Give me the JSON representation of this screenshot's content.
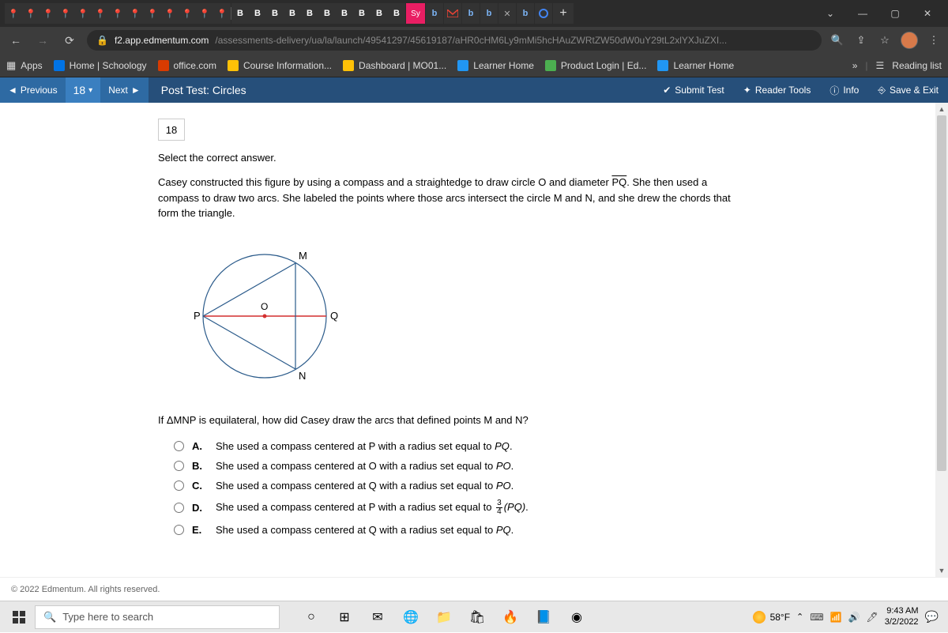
{
  "window": {
    "minimize": "—",
    "maximize": "▢",
    "close": "✕"
  },
  "tabs": {
    "pins": [
      "📍",
      "📍",
      "📍",
      "📍",
      "📍",
      "📍",
      "📍",
      "📍",
      "📍",
      "📍",
      "📍",
      "📍",
      "📍"
    ],
    "bs": [
      "B",
      "B",
      "B",
      "B",
      "B",
      "B",
      "B",
      "B",
      "B",
      "B"
    ],
    "sy": "Sy",
    "b1": "b",
    "m": "M",
    "b2": "b",
    "b3": "b",
    "x": "✕",
    "b4": "b",
    "plus": "+"
  },
  "url": {
    "lock": "🔒",
    "host": "f2.app.edmentum.com",
    "path": "/assessments-delivery/ua/la/launch/49541297/45619187/aHR0cHM6Ly9mMi5hcHAuZWRtZW50dW0uY29tL2xlYXJuZXI...",
    "search": "🔍",
    "share": "⇪",
    "star": "☆",
    "more": "⋮"
  },
  "bookmarks": {
    "apps": "Apps",
    "items": [
      {
        "icon": "#0073e6",
        "text": "Home | Schoology"
      },
      {
        "icon": "#d83b01",
        "text": "office.com"
      },
      {
        "icon": "#ffc107",
        "text": "Course Information..."
      },
      {
        "icon": "#ffc107",
        "text": "Dashboard | MO01..."
      },
      {
        "icon": "#2196f3",
        "text": "Learner Home"
      },
      {
        "icon": "#4caf50",
        "text": "Product Login | Ed..."
      },
      {
        "icon": "#2196f3",
        "text": "Learner Home"
      }
    ],
    "overflow": "»",
    "reading": "Reading list"
  },
  "assess": {
    "prev": "Previous",
    "count": "18",
    "next": "Next",
    "title": "Post Test: Circles",
    "submit": "Submit Test",
    "reader": "Reader Tools",
    "info": "Info",
    "save": "Save & Exit"
  },
  "question": {
    "number": "18",
    "instruction": "Select the correct answer.",
    "text_a": "Casey constructed this figure by using a compass and a straightedge to draw circle O and diameter ",
    "pq": "PQ",
    "text_b": ". She then used a compass to draw two arcs. She labeled the points where those arcs intersect the circle M and N, and she drew the chords that form the triangle.",
    "labels": {
      "P": "P",
      "Q": "Q",
      "M": "M",
      "N": "N",
      "O": "O"
    },
    "sub": "If ΔMNP is equilateral, how did Casey draw the arcs that defined points M and N?",
    "choices": [
      {
        "l": "A.",
        "t1": "She used a compass centered at P with a radius set equal to ",
        "it": "PQ",
        "t2": "."
      },
      {
        "l": "B.",
        "t1": "She used a compass centered at O with a radius set equal to ",
        "it": "PO",
        "t2": "."
      },
      {
        "l": "C.",
        "t1": "She used a compass centered at Q with a radius set equal to ",
        "it": "PO",
        "t2": "."
      },
      {
        "l": "D.",
        "t1": "She used a compass centered at P with a radius set equal to ",
        "frac": {
          "n": "3",
          "d": "4"
        },
        "it": "(PQ)",
        "t2": "."
      },
      {
        "l": "E.",
        "t1": "She used a compass centered at Q with a radius set equal to ",
        "it": "PQ",
        "t2": "."
      }
    ]
  },
  "footer": "© 2022 Edmentum. All rights reserved.",
  "taskbar": {
    "search": "Type here to search",
    "weather": "58°F",
    "time": "9:43 AM",
    "date": "3/2/2022"
  }
}
